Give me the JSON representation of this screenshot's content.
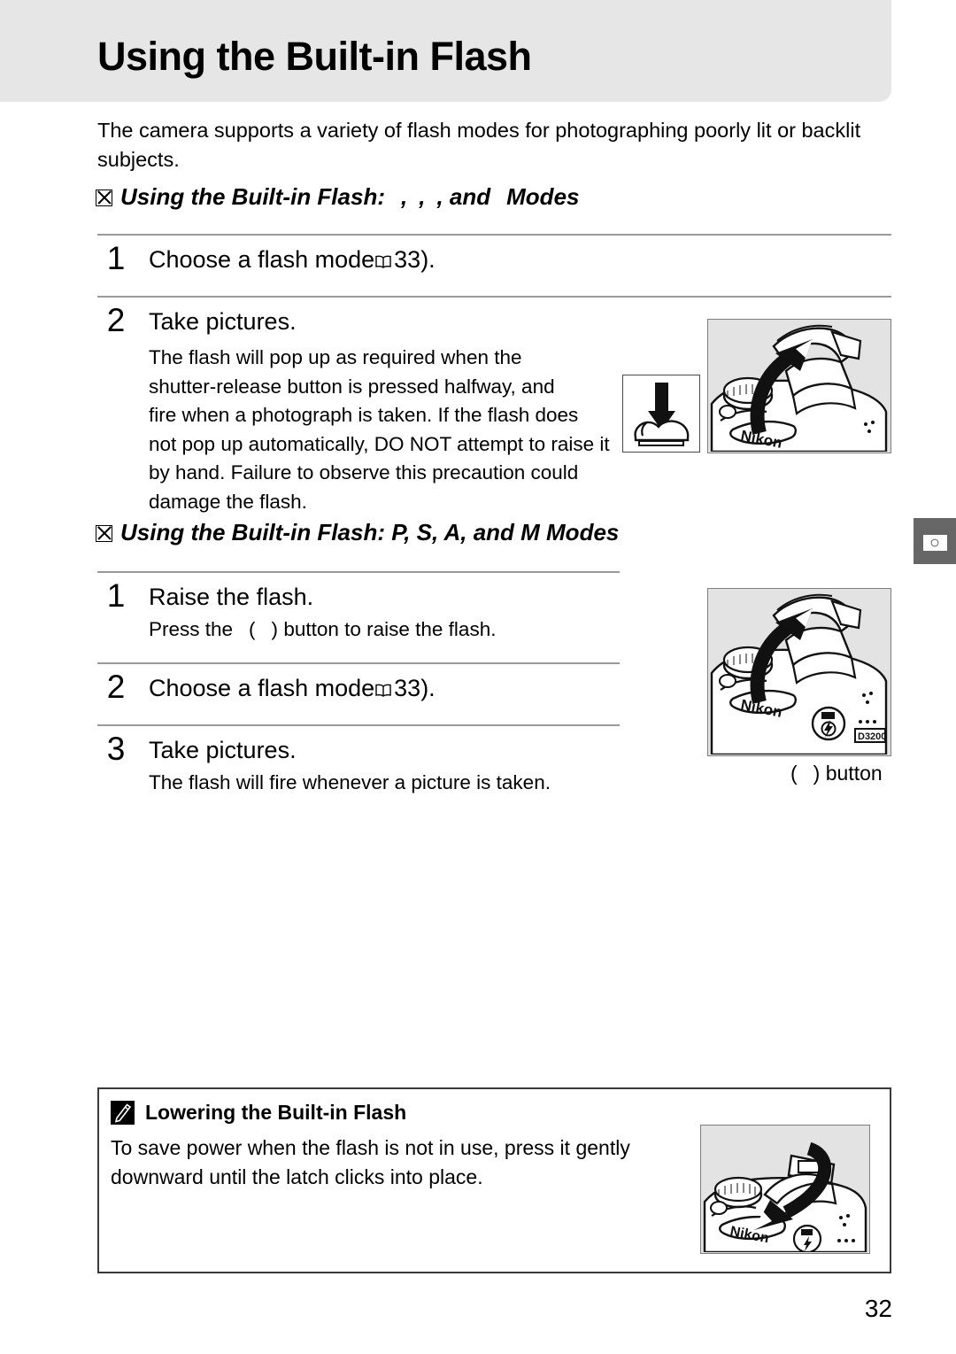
{
  "page": {
    "title": "Using the Built-in Flash",
    "number": "32",
    "intro": "The camera supports a variety of flash modes for photographing poorly lit or backlit subjects."
  },
  "side_tab": {
    "icon": "camera-icon"
  },
  "sections": [
    {
      "id": "auto-modes",
      "heading_prefix": "Using the Built-in Flash:",
      "heading_suffix": ", and",
      "heading_tail": "Modes",
      "heading_separator": ",",
      "steps": [
        {
          "number": "1",
          "title_before": "Choose a flash mode",
          "title_glyph": "book-icon",
          "title_after": "33).",
          "body": ""
        },
        {
          "number": "2",
          "title": "Take pictures.",
          "body": "The flash will pop up as required when the shutter-release button is pressed halfway, and fire when a photograph is taken. If the flash does not pop up automatically, DO NOT attempt to raise it by hand. Failure to observe this precaution could damage the flash.",
          "body_lines": [
            "The flash will pop up as required when the",
            "shutter-release button is pressed halfway, and",
            "fire when a photograph is taken.  If the flash does",
            "not pop up automatically, DO NOT attempt to raise it",
            "by hand. Failure to observe this precaution could",
            "damage the flash."
          ],
          "emphasis": "DO NOT"
        }
      ],
      "illustration": "camera-flash-raise-icon",
      "warning_illustration": "hand-press-down-icon"
    },
    {
      "id": "psam-modes",
      "heading": "Using the Built-in Flash: P, S, A, and M Modes",
      "steps": [
        {
          "number": "1",
          "title": "Raise the flash.",
          "body_before": "Press the",
          "body_paren_open": "(",
          "body_paren_close": ")",
          "body_after": "button to raise the flash."
        },
        {
          "number": "2",
          "title_before": "Choose a flash mode",
          "title_glyph": "book-icon",
          "title_after": "33)."
        },
        {
          "number": "3",
          "title": "Take pictures.",
          "body": "The flash will fire whenever a picture is taken."
        }
      ],
      "illustration": "camera-flash-raise-icon",
      "caption_paren_open": "(",
      "caption_paren_close": ")",
      "caption_label": "button"
    }
  ],
  "note": {
    "icon": "pencil-note-icon",
    "title": "Lowering the Built-in Flash",
    "text": "To save power when the flash is not in use, press it gently downward until the latch clicks into place.",
    "lines": [
      "To save power when the flash is not in use, press it gently",
      "downward until the latch clicks into place."
    ],
    "illustration": "camera-flash-lower-icon"
  },
  "colors": {
    "header_band": "#e6e6e6",
    "illustration_bg": "#e3e3e3",
    "rule": "#9a9a9a",
    "side_tab": "#666666",
    "text": "#000000"
  }
}
